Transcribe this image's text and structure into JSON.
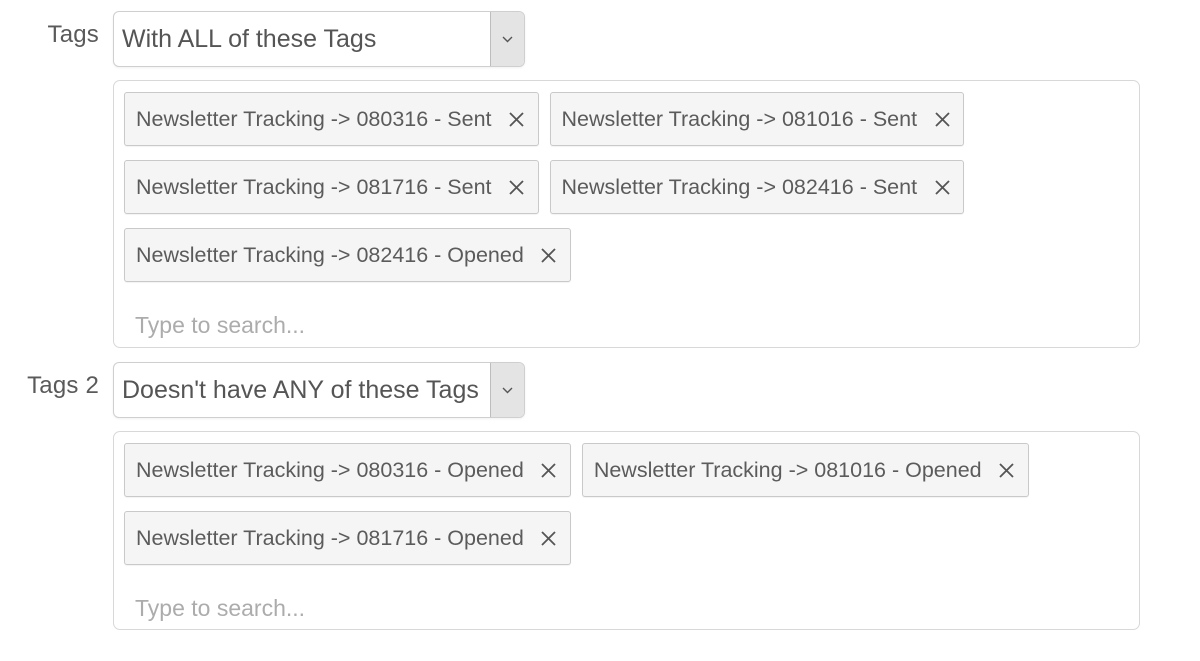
{
  "filters": [
    {
      "label": "Tags",
      "condition": {
        "selected": "With ALL of these Tags",
        "icon": "chevron-down-icon"
      },
      "tags": [
        {
          "text": "Newsletter Tracking -> 080316 - Sent",
          "remove_icon": "close-icon"
        },
        {
          "text": "Newsletter Tracking -> 081016 - Sent",
          "remove_icon": "close-icon"
        },
        {
          "text": "Newsletter Tracking -> 081716 - Sent",
          "remove_icon": "close-icon"
        },
        {
          "text": "Newsletter Tracking -> 082416 - Sent",
          "remove_icon": "close-icon"
        },
        {
          "text": "Newsletter Tracking -> 082416 - Opened",
          "remove_icon": "close-icon"
        }
      ],
      "search": {
        "value": "",
        "placeholder": "Type to search..."
      }
    },
    {
      "label": "Tags 2",
      "condition": {
        "selected": "Doesn't have ANY of these Tags",
        "icon": "chevron-down-icon"
      },
      "tags": [
        {
          "text": "Newsletter Tracking -> 080316 - Opened",
          "remove_icon": "close-icon"
        },
        {
          "text": "Newsletter Tracking -> 081016 - Opened",
          "remove_icon": "close-icon"
        },
        {
          "text": "Newsletter Tracking -> 081716 - Opened",
          "remove_icon": "close-icon"
        }
      ],
      "search": {
        "value": "",
        "placeholder": "Type to search..."
      }
    }
  ],
  "colors": {
    "text": "#555555",
    "placeholder": "#acacac",
    "tag_background": "#f5f5f5",
    "tag_border": "#c9c9c9",
    "select_arrow_background": "#e4e4e4",
    "box_border": "#d8d8d8"
  }
}
